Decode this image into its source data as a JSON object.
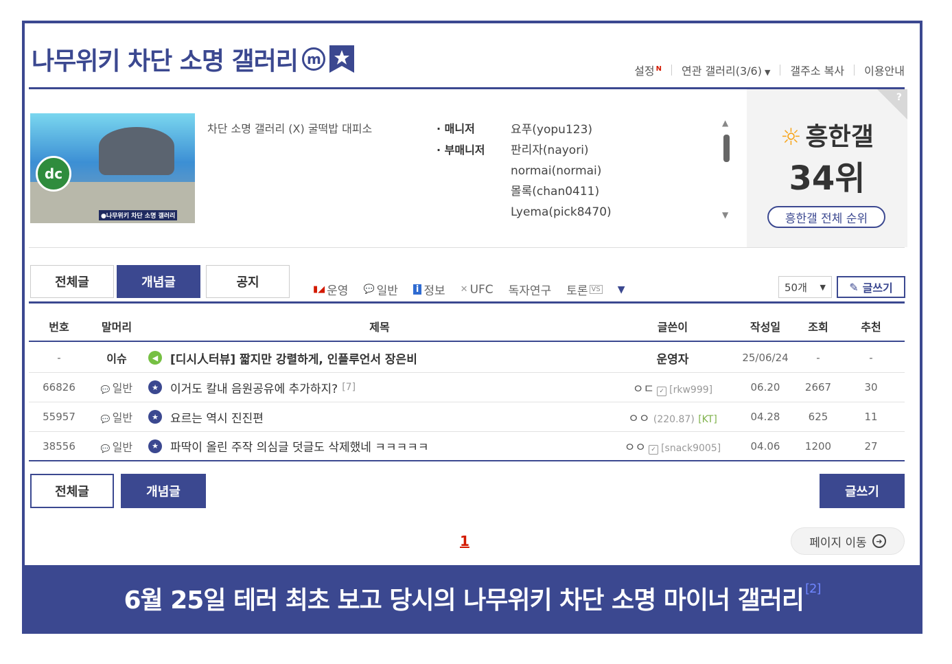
{
  "header": {
    "title": "나무위키 차단 소명 갤러리",
    "badge": "m",
    "links": {
      "settings": "설정",
      "settings_new": "N",
      "related": "연관 갤러리(3/6)",
      "copy_address": "갤주소 복사",
      "guide": "이용안내"
    }
  },
  "info": {
    "thumb_strip": "●나무위키 차단 소명 갤러리",
    "thumb_logo": "dc",
    "description": "차단 소명 갤러리 (X) 굴떡밥 대피소",
    "manager_role": "· 매니저",
    "submanager_role": "· 부매니저",
    "managers": [
      "요푸(yopu123)",
      "판리자(nayori)",
      "normai(normai)",
      "몰록(chan0411)",
      "Lyema(pick8470)"
    ]
  },
  "rank": {
    "question": "?",
    "title": "흥한갤",
    "value": "34위",
    "button": "흥한갤 전체 순위"
  },
  "tabs": {
    "all": "전체글",
    "concept": "개념글",
    "notice": "공지"
  },
  "heads": {
    "h1": "운영",
    "h2": "일반",
    "h3": "정보",
    "h4": "UFC",
    "h5": "독자연구",
    "h6": "토론",
    "h6_badge": "VS"
  },
  "controls": {
    "per_page": "50개",
    "write": "글쓰기"
  },
  "columns": {
    "no": "번호",
    "head": "말머리",
    "title": "제목",
    "writer": "글쓴이",
    "date": "작성일",
    "views": "조회",
    "recommend": "추천"
  },
  "rows": [
    {
      "no": "-",
      "head": "이슈",
      "title": "[디시人터뷰] 짧지만 강렬하게, 인플루언서 장은비",
      "comments": "",
      "writer": "운영자",
      "ip": "",
      "isp": "",
      "date": "25/06/24",
      "views": "-",
      "recommend": "-"
    },
    {
      "no": "66826",
      "head": "일반",
      "title": "이거도 칼내 음원공유에 추가하지?",
      "comments": "[7]",
      "writer": "ㅇㄷ",
      "ip": "[rkw999]",
      "isp": "",
      "date": "06.20",
      "views": "2667",
      "recommend": "30"
    },
    {
      "no": "55957",
      "head": "일반",
      "title": "요르는 역시 진진편",
      "comments": "",
      "writer": "ㅇㅇ",
      "ip": "(220.87)",
      "isp": "[KT]",
      "date": "04.28",
      "views": "625",
      "recommend": "11"
    },
    {
      "no": "38556",
      "head": "일반",
      "title": "파딱이 올린 주작 의심글 덧글도 삭제했네 ㅋㅋㅋㅋㅋ",
      "comments": "",
      "writer": "ㅇㅇ",
      "ip": "[snack9005]",
      "isp": "",
      "date": "04.06",
      "views": "1200",
      "recommend": "27"
    }
  ],
  "bottom": {
    "all": "전체글",
    "concept": "개념글",
    "write": "글쓰기",
    "page": "1",
    "page_jump": "페이지 이동"
  },
  "caption": {
    "text": "6월 25일 테러 최초 보고 당시의 나무위키 차단 소명 마이너 갤러리",
    "footnote": "[2]"
  },
  "colors": {
    "brand": "#3b4890",
    "accent_red": "#d31900",
    "sun": "#f7a418"
  }
}
